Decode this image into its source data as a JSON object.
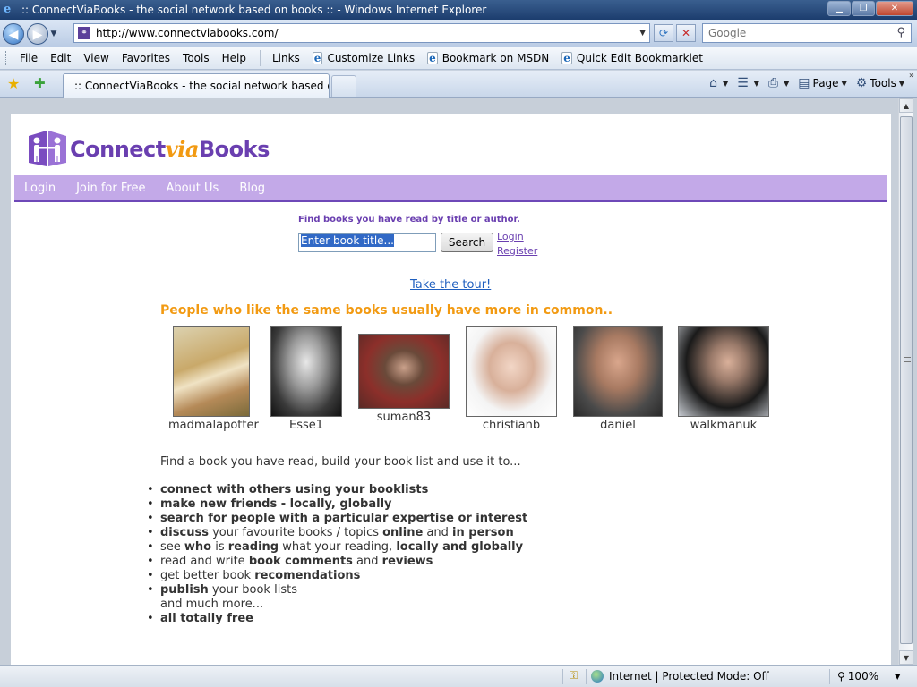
{
  "window": {
    "title": ":: ConnectViaBooks - the social network based on books :: - Windows Internet Explorer"
  },
  "address": {
    "url": "http://www.connectviabooks.com/",
    "search_placeholder": "Google"
  },
  "menu": {
    "items": [
      "File",
      "Edit",
      "View",
      "Favorites",
      "Tools",
      "Help"
    ],
    "links_label": "Links",
    "links": [
      "Customize Links",
      "Bookmark on MSDN",
      "Quick Edit Bookmarklet"
    ]
  },
  "tabs": {
    "active_title": ":: ConnectViaBooks - the social network based on..."
  },
  "commandbar": {
    "page_label": "Page",
    "tools_label": "Tools"
  },
  "site": {
    "logo_connect": "Connect",
    "logo_via": "via",
    "logo_books": "Books",
    "nav": [
      "Login",
      "Join for Free",
      "About Us",
      "Blog"
    ],
    "find_label": "Find books you have read by title or author.",
    "book_input_value": "Enter book title...",
    "search_button": "Search",
    "login_link": "Login",
    "register_link": "Register",
    "tour_link": "Take the tour!",
    "headline": "People who like the same books usually have more in common..",
    "people": [
      "madmalapotter",
      "Esse1",
      "suman83",
      "christianb",
      "daniel",
      "walkmanuk"
    ],
    "intro": "Find a book you have read, build your book list and use it to...",
    "features": {
      "f1": "connect with others using your booklists",
      "f2": "make new friends - locally, globally",
      "f3": "search for people with a particular expertise or interest",
      "f4a": "discuss",
      "f4b": " your favourite books / topics ",
      "f4c": "online",
      "f4d": " and ",
      "f4e": "in person",
      "f5a": "see ",
      "f5b": "who",
      "f5c": " is ",
      "f5d": "reading",
      "f5e": " what your reading, ",
      "f5f": "locally and globally",
      "f6a": "read and write ",
      "f6b": "book comments",
      "f6c": " and ",
      "f6d": "reviews",
      "f7a": "get better book ",
      "f7b": "recomendations",
      "f8a": "publish",
      "f8b": " your book lists",
      "f9": "and much more...",
      "f10": "all totally free"
    }
  },
  "status": {
    "zone": "Internet | Protected Mode: Off",
    "zoom": "100%"
  },
  "colors": {
    "brand_purple": "#6a3fb0",
    "nav_lavender": "#c3a9e8",
    "accent_orange": "#f29a12",
    "link_blue": "#1f5fbf"
  }
}
